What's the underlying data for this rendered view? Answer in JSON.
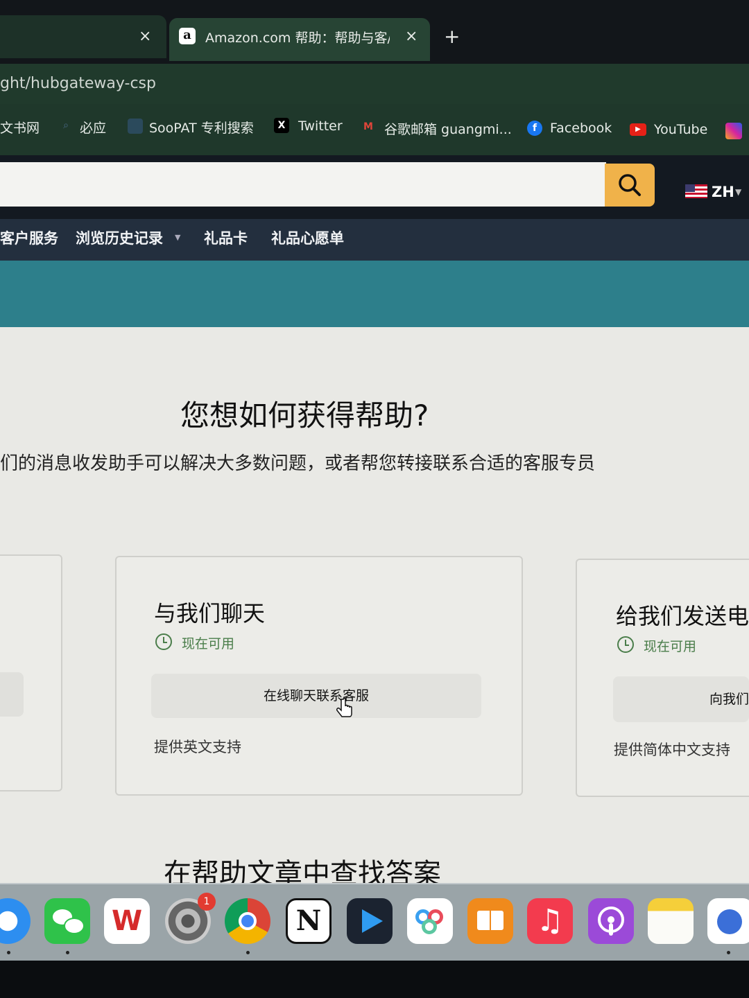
{
  "browser": {
    "inactive_tab_close": "×",
    "active_tab": {
      "favicon": "a",
      "title": "Amazon.com 帮助：帮助与客/",
      "close": "×"
    },
    "new_tab": "+",
    "url": "ght/hubgateway-csp",
    "bookmarks": [
      {
        "label": "文书网",
        "icon": "bookmark-icon"
      },
      {
        "label": "必应",
        "icon": "search-icon"
      },
      {
        "label": "SooPAT 专利搜索",
        "icon": "bookmark-icon"
      },
      {
        "label": "Twitter",
        "icon": "x-logo-icon",
        "glyph": "X"
      },
      {
        "label": "谷歌邮箱 guangmi...",
        "icon": "gmail-icon",
        "glyph": "M"
      },
      {
        "label": "Facebook",
        "icon": "facebook-icon",
        "glyph": "f"
      },
      {
        "label": "YouTube",
        "icon": "youtube-icon",
        "glyph": "▶"
      },
      {
        "label": "",
        "icon": "instagram-icon"
      }
    ]
  },
  "amazon": {
    "lang": "ZH",
    "nav": [
      "客户服务",
      "浏览历史记录",
      "礼品卡",
      "礼品心愿单"
    ]
  },
  "help": {
    "title": "您想如何获得帮助?",
    "subtitle": "们的消息收发助手可以解决大多数问题，或者帮您转接联系合适的客服专员",
    "cards": [
      {
        "title": "与我们聊天",
        "availability": "现在可用",
        "button": "在线聊天联系客服",
        "support": "提供英文支持"
      },
      {
        "title": "给我们发送电",
        "availability": "现在可用",
        "button": "向我们",
        "support": "提供简体中文支持"
      }
    ],
    "section_title": "在帮助文章中查找答案"
  },
  "dock": {
    "badge": "1",
    "apps": [
      "safari-icon",
      "wechat-icon",
      "wps-icon",
      "system-settings-icon",
      "chrome-icon",
      "notion-icon",
      "infuse-icon",
      "baidu-netdisk-icon",
      "books-icon",
      "music-icon",
      "podcasts-icon",
      "notes-icon",
      "browser-icon"
    ]
  },
  "colors": {
    "amazon_dark": "#131921",
    "amazon_nav": "#232f3e",
    "search_button": "#f0b24a",
    "teal_banner": "#2d7f8b",
    "available_green": "#4a7d4a"
  }
}
